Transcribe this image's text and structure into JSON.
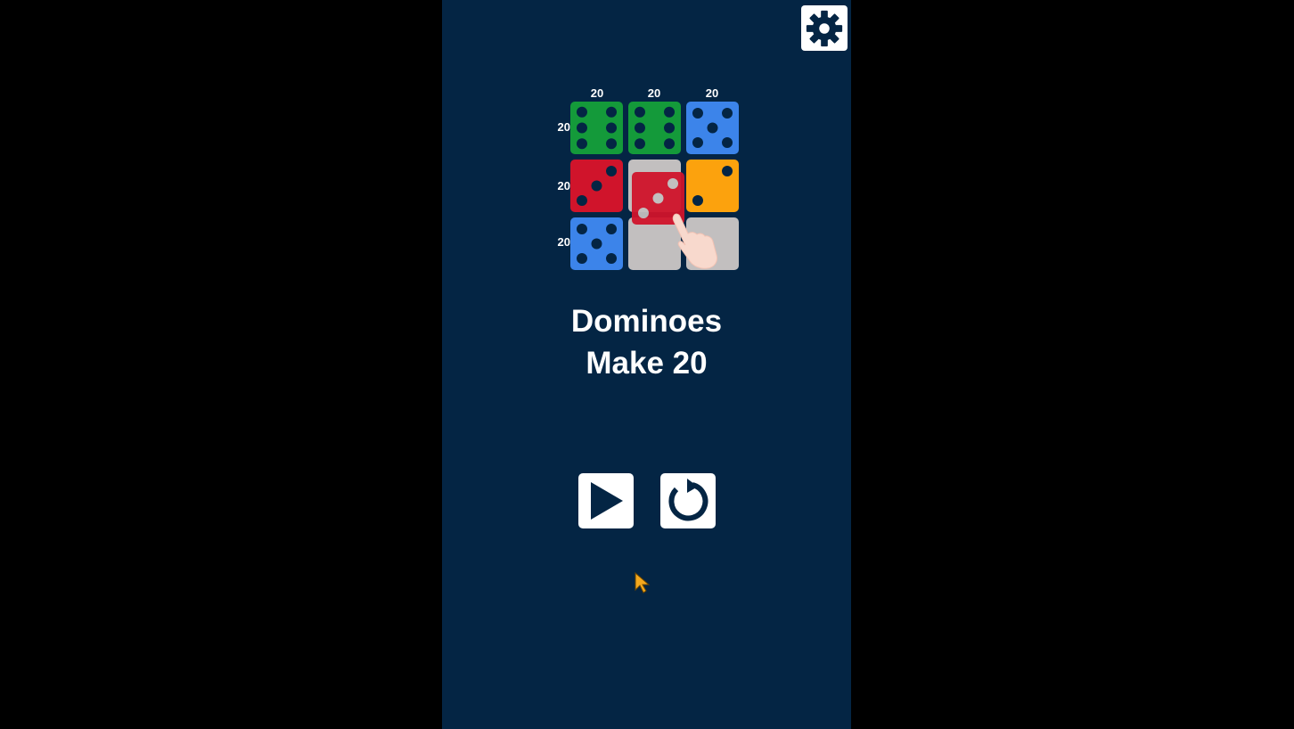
{
  "settings": {
    "icon": "gear-icon"
  },
  "board": {
    "column_sums": [
      "20",
      "20",
      "20"
    ],
    "row_sums": [
      "20",
      "20",
      "20"
    ],
    "tiles": [
      {
        "color": "#149a3a",
        "pips": 6
      },
      {
        "color": "#149a3a",
        "pips": 6
      },
      {
        "color": "#3c84ea",
        "pips": 5
      },
      {
        "color": "#d0142b",
        "pips": 3
      },
      {
        "color": "#c2bfbf",
        "pips": 0
      },
      {
        "color": "#fca20d",
        "pips": 2
      },
      {
        "color": "#3c84ea",
        "pips": 5
      },
      {
        "color": "#c2bfbf",
        "pips": 0
      },
      {
        "color": "#c2bfbf",
        "pips": 0
      }
    ],
    "dragged_tile": {
      "color": "#d0142b",
      "pips": 3
    }
  },
  "title": {
    "line1": "Dominoes",
    "line2": "Make 20"
  },
  "buttons": {
    "play_icon": "play-icon",
    "restart_icon": "restart-icon"
  },
  "colors": {
    "background": "#042544",
    "pip": "#042544",
    "empty_tile": "#c2bfbf"
  }
}
